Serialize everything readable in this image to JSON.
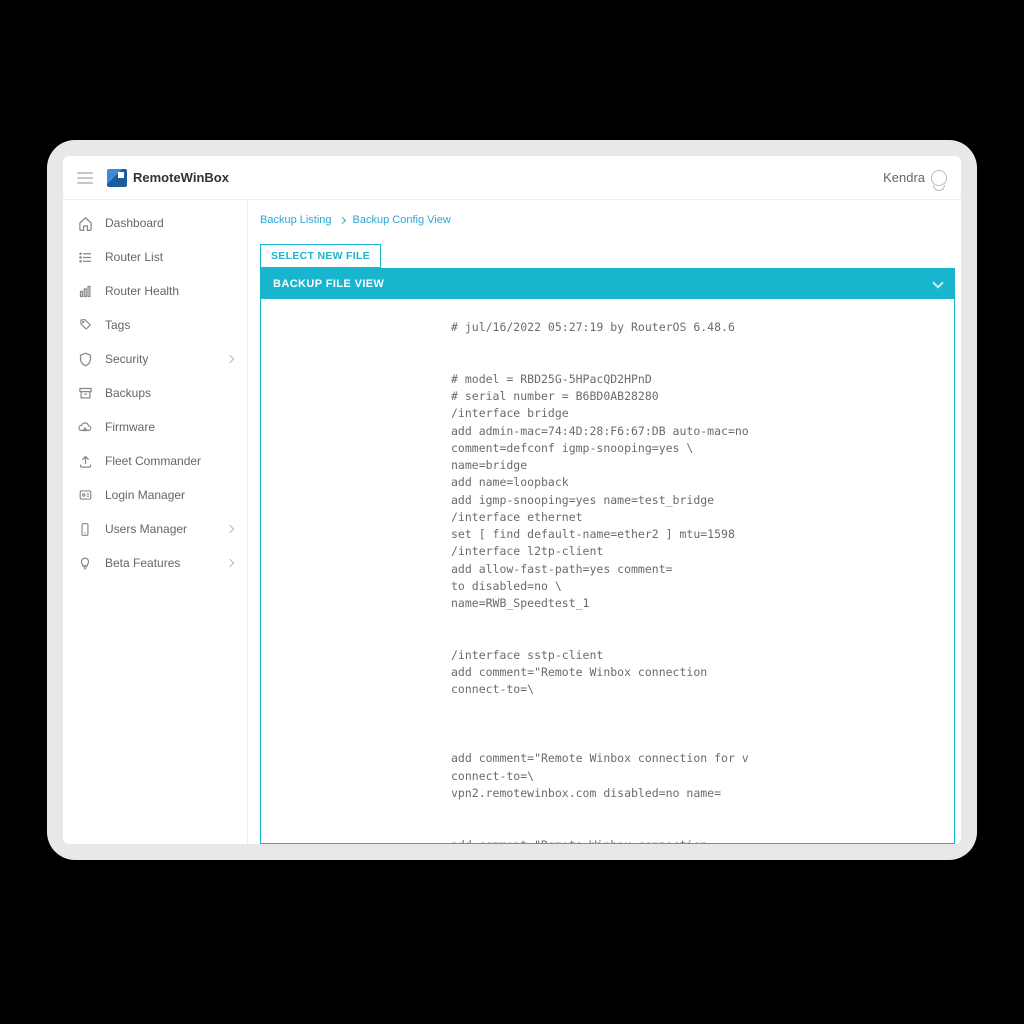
{
  "brand": "RemoteWinBox",
  "user": {
    "name": "Kendra"
  },
  "sidebar": {
    "items": [
      {
        "label": "Dashboard",
        "icon": "home-icon",
        "expandable": false
      },
      {
        "label": "Router List",
        "icon": "list-icon",
        "expandable": false
      },
      {
        "label": "Router Health",
        "icon": "chart-icon",
        "expandable": false
      },
      {
        "label": "Tags",
        "icon": "tag-icon",
        "expandable": false
      },
      {
        "label": "Security",
        "icon": "shield-icon",
        "expandable": true
      },
      {
        "label": "Backups",
        "icon": "archive-icon",
        "expandable": false
      },
      {
        "label": "Firmware",
        "icon": "cloud-icon",
        "expandable": false
      },
      {
        "label": "Fleet Commander",
        "icon": "upload-icon",
        "expandable": false
      },
      {
        "label": "Login Manager",
        "icon": "badge-icon",
        "expandable": false
      },
      {
        "label": "Users Manager",
        "icon": "users-icon",
        "expandable": true
      },
      {
        "label": "Beta Features",
        "icon": "bulb-icon",
        "expandable": true
      }
    ]
  },
  "breadcrumb": {
    "items": [
      "Backup Listing",
      "Backup Config View"
    ]
  },
  "actions": {
    "select_new_file": "SELECT NEW FILE"
  },
  "panel": {
    "title": "BACKUP FILE VIEW",
    "content_lines": [
      "# jul/16/2022 05:27:19 by RouterOS 6.48.6",
      "",
      "",
      "# model = RBD25G-5HPacQD2HPnD",
      "# serial number = B6BD0AB28280",
      "/interface bridge",
      "add admin-mac=74:4D:28:F6:67:DB auto-mac=no",
      "comment=defconf igmp-snooping=yes \\",
      "name=bridge",
      "add name=loopback",
      "add igmp-snooping=yes name=test_bridge",
      "/interface ethernet",
      "set [ find default-name=ether2 ] mtu=1598",
      "/interface l2tp-client",
      "add allow-fast-path=yes comment=",
      "to                        disabled=no \\",
      "name=RWB_Speedtest_1",
      "",
      "",
      "/interface sstp-client",
      "add comment=\"Remote Winbox connection",
      "connect-to=\\",
      "",
      "",
      "",
      "add comment=\"Remote Winbox connection for v",
      "connect-to=\\",
      "vpn2.remotewinbox.com disabled=no name=",
      "",
      "",
      "add comment=\"Remote Winbox connection"
    ]
  }
}
